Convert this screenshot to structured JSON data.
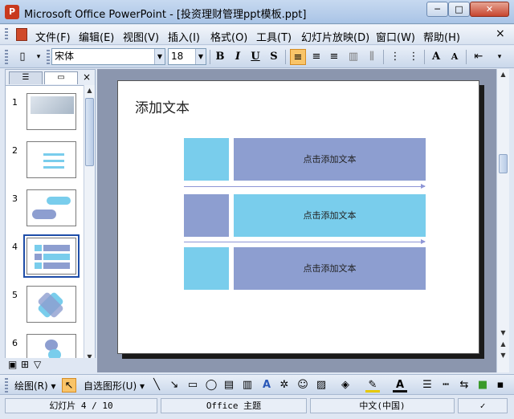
{
  "window": {
    "title": "Microsoft Office PowerPoint - [投资理财管理ppt模板.ppt]",
    "minimize": "─",
    "maximize": "□",
    "close": "✕"
  },
  "menu": {
    "items": [
      "文件(F)",
      "编辑(E)",
      "视图(V)",
      "插入(I)",
      "格式(O)",
      "工具(T)",
      "幻灯片放映(D)",
      "窗口(W)",
      "帮助(H)"
    ]
  },
  "toolbar": {
    "font_name": "宋体",
    "font_size": "18",
    "bold": "B",
    "italic": "I",
    "underline": "U",
    "shadow": "S",
    "grow_font": "A",
    "shrink_font": "A"
  },
  "left_panel": {
    "tabs": [
      "outline-tab",
      "slides-tab"
    ],
    "close": "×",
    "slide_numbers": [
      "1",
      "2",
      "3",
      "4",
      "5",
      "6"
    ],
    "selected_slide": 4
  },
  "slide": {
    "title": "添加文本",
    "rows": [
      {
        "text": "点击添加文本",
        "left_color": "#79cdec",
        "right_color": "#8d9ed0"
      },
      {
        "text": "点击添加文本",
        "left_color": "#8d9ed0",
        "right_color": "#79cdec"
      },
      {
        "text": "点击添加文本",
        "left_color": "#79cdec",
        "right_color": "#8d9ed0"
      }
    ],
    "arrow_color": "#8e96d6"
  },
  "drawing_toolbar": {
    "draw_label": "绘图(R)",
    "autoshapes_label": "自选图形(U)"
  },
  "status": {
    "slide_info": "幻灯片 4 / 10",
    "theme": "Office 主题",
    "language": "中文(中国)"
  }
}
